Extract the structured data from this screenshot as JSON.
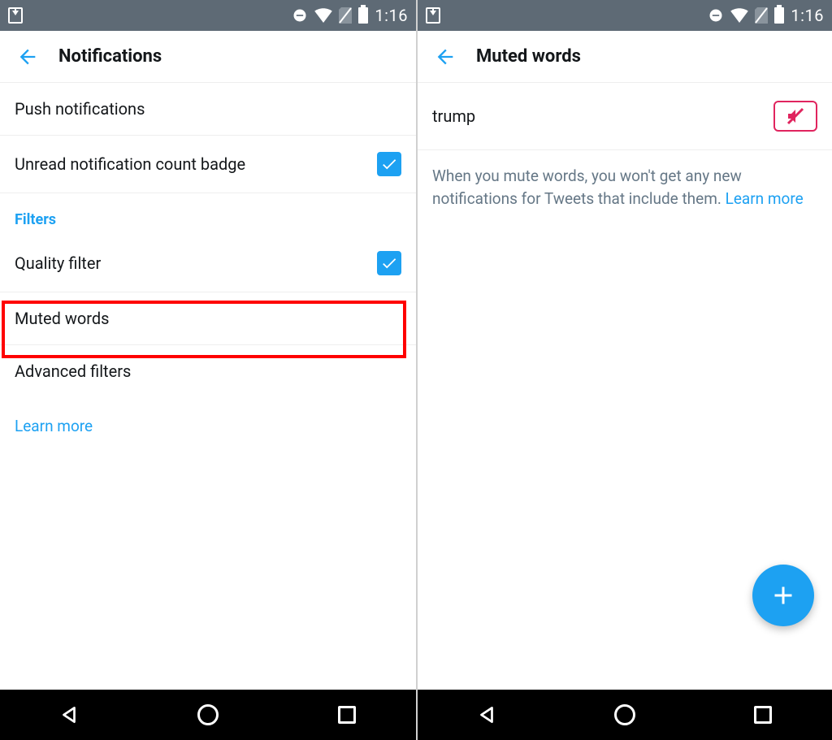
{
  "status": {
    "time": "1:16"
  },
  "left": {
    "title": "Notifications",
    "rows": {
      "push": "Push notifications",
      "unread": "Unread notification count badge",
      "filters_header": "Filters",
      "quality": "Quality filter",
      "muted": "Muted words",
      "advanced": "Advanced filters",
      "learn_more": "Learn more"
    },
    "checks": {
      "unread": true,
      "quality": true
    }
  },
  "right": {
    "title": "Muted words",
    "word": "trump",
    "helper": "When you mute words, you won't get any new notifications for Tweets that include them. ",
    "learn_more": "Learn more"
  }
}
